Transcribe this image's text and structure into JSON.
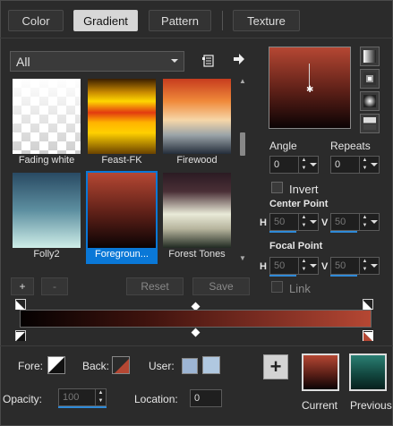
{
  "tabs": [
    {
      "label": "Color"
    },
    {
      "label": "Gradient"
    },
    {
      "label": "Pattern"
    },
    {
      "label": "Texture"
    }
  ],
  "category_select": {
    "value": "All"
  },
  "swatches": [
    {
      "label": "Fading white"
    },
    {
      "label": "Feast-FK"
    },
    {
      "label": "Firewood"
    },
    {
      "label": "Folly2"
    },
    {
      "label": "Foregroun..."
    },
    {
      "label": "Forest Tones"
    }
  ],
  "selected_swatch": "Foregroun...",
  "list_buttons": {
    "add": "+",
    "remove": "-",
    "reset": "Reset",
    "save": "Save"
  },
  "angle": {
    "label": "Angle",
    "value": "0"
  },
  "repeats": {
    "label": "Repeats",
    "value": "0"
  },
  "invert": {
    "label": "Invert",
    "checked": false
  },
  "center_point": {
    "label": "Center Point",
    "h_label": "H",
    "h": "50",
    "v_label": "V",
    "v": "50"
  },
  "focal_point": {
    "label": "Focal Point",
    "h_label": "H",
    "h": "50",
    "v_label": "V",
    "v": "50"
  },
  "link": {
    "label": "Link",
    "checked": false
  },
  "bottom": {
    "fore_label": "Fore:",
    "back_label": "Back:",
    "user_label": "User:",
    "opacity_label": "Opacity:",
    "opacity_value": "100",
    "location_label": "Location:",
    "location_value": "0",
    "current_label": "Current",
    "previous_label": "Previous",
    "add_button": "+"
  },
  "colors": {
    "accent": "#0a78d7",
    "gradient_start": "#b54733",
    "gradient_end": "#050101",
    "previous_top": "#2a7f73",
    "previous_bottom": "#06201d",
    "user_color_1": "#9db5d4",
    "user_color_2": "#b0c8e0"
  },
  "icons": {
    "library": "list-document-icon",
    "export": "arrow-right-icon"
  }
}
